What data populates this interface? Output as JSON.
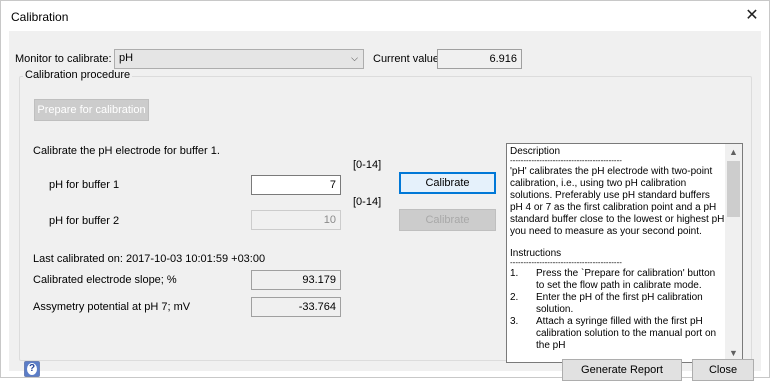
{
  "window": {
    "title": "Calibration",
    "close_glyph": "✕"
  },
  "monitor": {
    "label": "Monitor to calibrate:",
    "selected": "pH",
    "current_value_label": "Current value",
    "current_value": "6.916"
  },
  "procedure": {
    "group_title": "Calibration procedure",
    "prepare_button": "Prepare for calibration",
    "instruction": "Calibrate the pH electrode for buffer 1.",
    "buffer1": {
      "label": "pH for buffer 1",
      "range": "[0-14]",
      "value": "7",
      "button": "Calibrate"
    },
    "buffer2": {
      "label": "pH for buffer 2",
      "range": "[0-14]",
      "value": "10",
      "button": "Calibrate"
    },
    "last_calibrated": "Last calibrated on: 2017-10-03 10:01:59 +03:00",
    "slope": {
      "label": "Calibrated electrode slope; %",
      "value": "93.179"
    },
    "asymmetry": {
      "label": "Assymetry potential at pH 7; mV",
      "value": "-33.764"
    }
  },
  "description": {
    "heading": "Description",
    "separator": "------------------------------------------",
    "body": "'pH' calibrates the pH electrode with two-point calibration, i.e., using two pH calibration solutions. Preferably use pH standard buffers pH 4 or 7 as the first calibration point and a pH standard buffer close to the lowest or highest pH you need to measure as your second point.",
    "instructions_heading": "Instructions",
    "steps": [
      {
        "n": "1.",
        "text": "Press the `Prepare for calibration' button to set the flow path in calibrate mode."
      },
      {
        "n": "2.",
        "text": "Enter the pH of the first pH calibration solution."
      },
      {
        "n": "3.",
        "text": "Attach a syringe filled with the first pH calibration solution to the manual port on the pH"
      }
    ]
  },
  "footer": {
    "generate_report": "Generate Report",
    "close": "Close"
  },
  "icons": {
    "help": "help-icon",
    "dropdown": "chevron-down-icon",
    "close": "close-icon"
  },
  "colors": {
    "focus_border": "#0078d7",
    "client_bg": "#f0f0f0"
  }
}
